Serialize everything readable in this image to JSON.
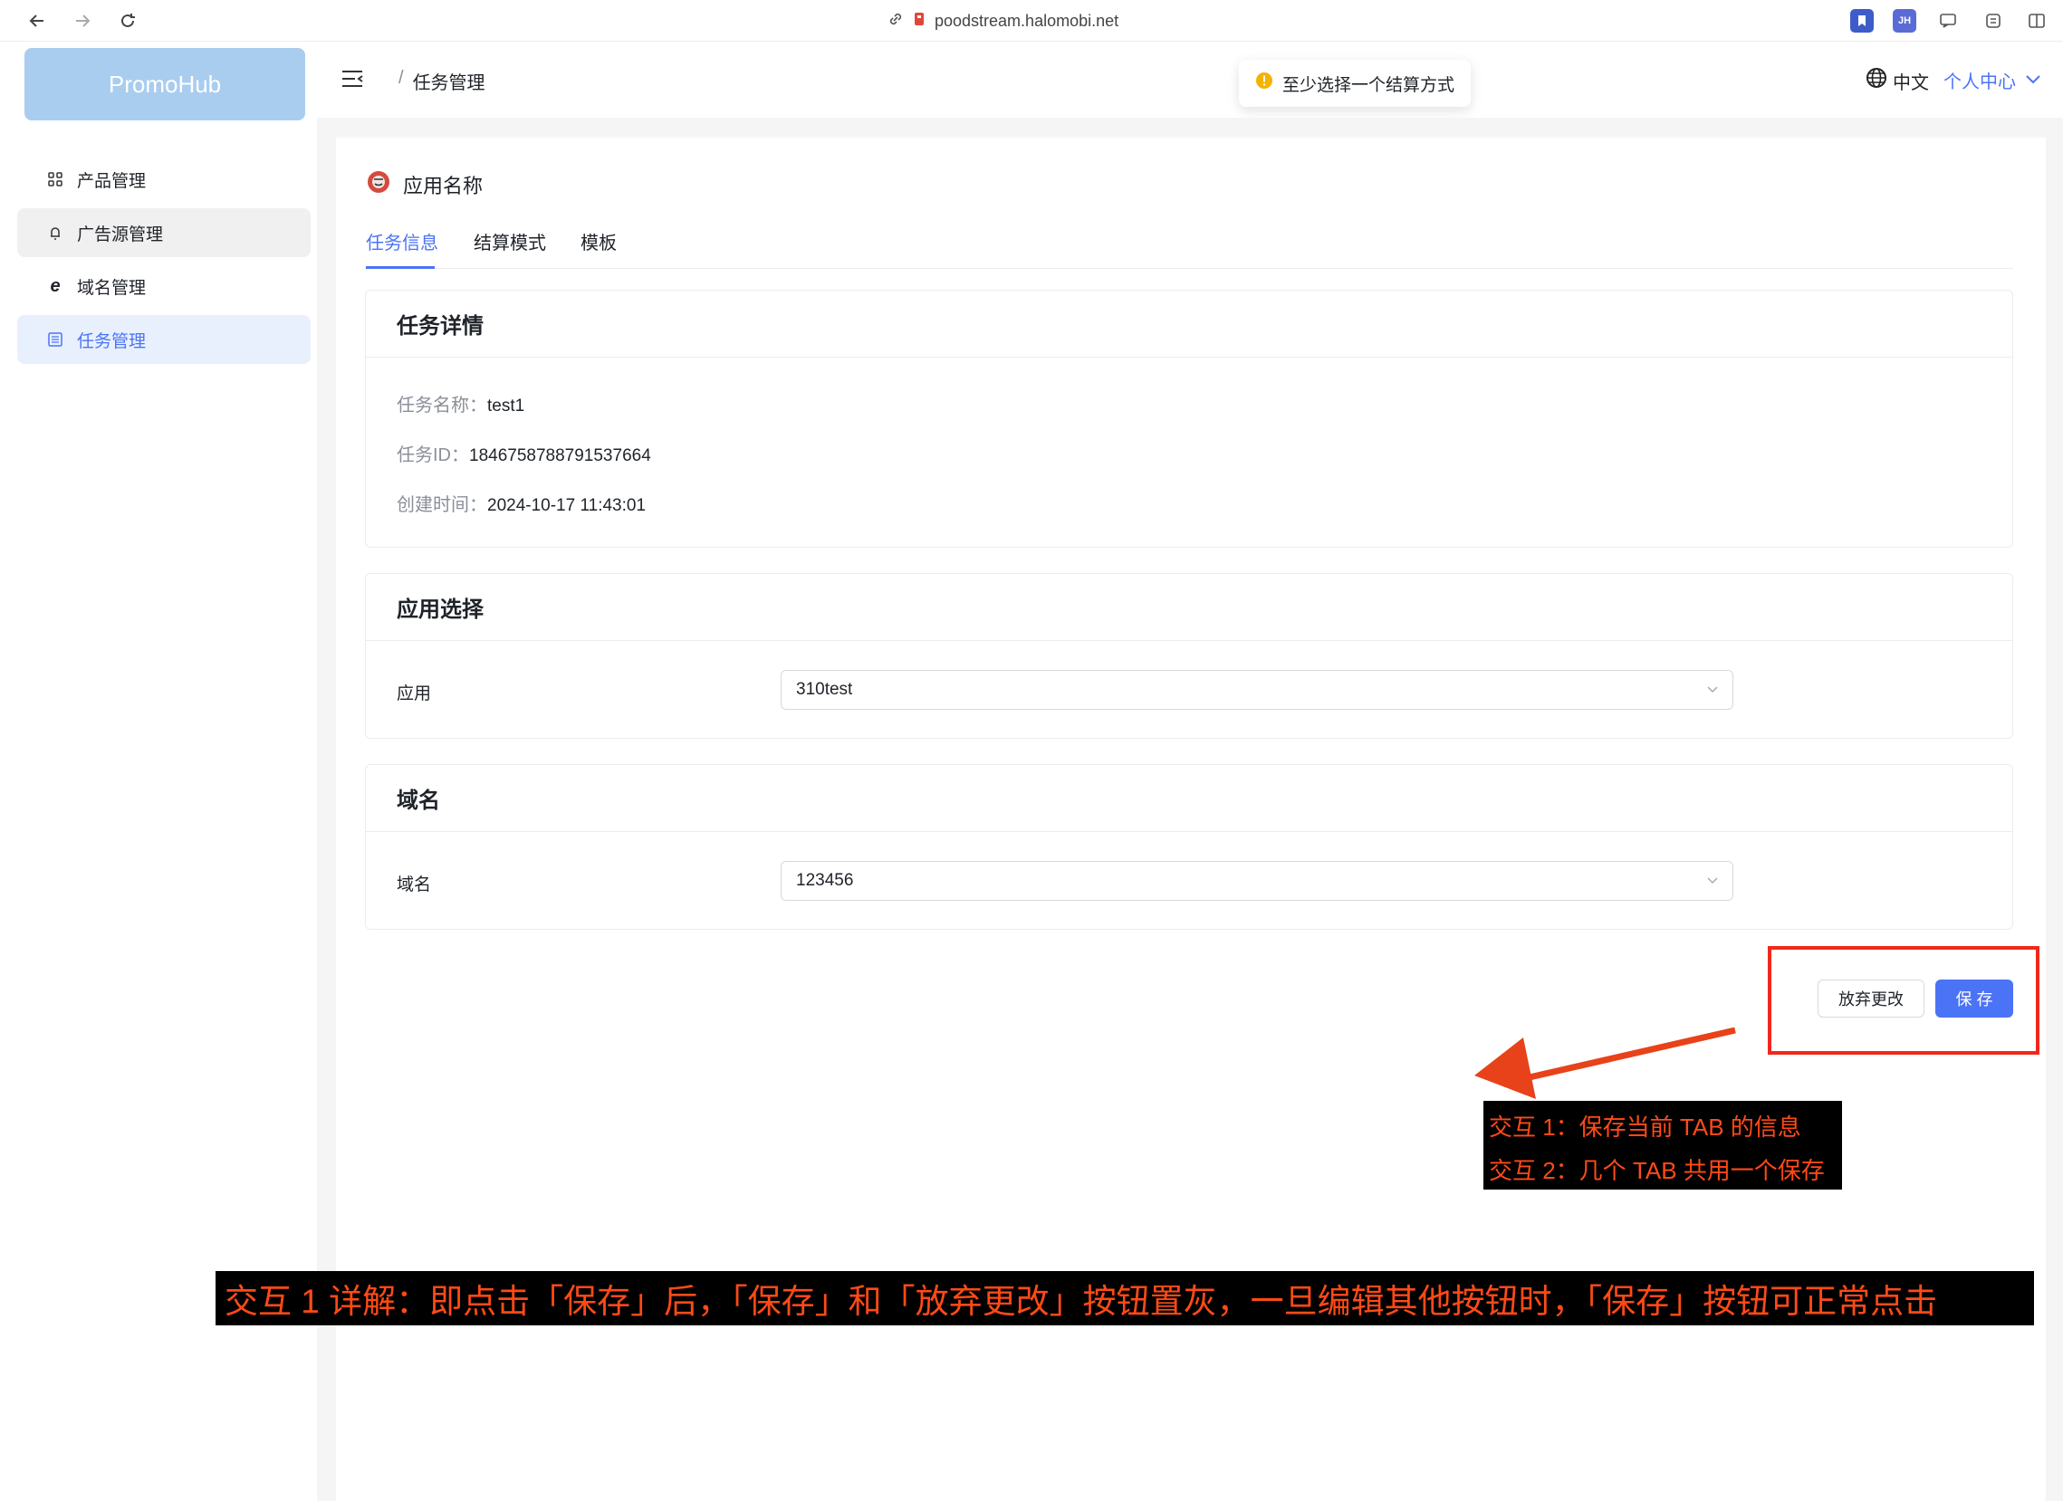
{
  "browser": {
    "url": "poodstream.halomobi.net"
  },
  "app": {
    "brand": "PromoHub"
  },
  "sidebar": {
    "items": [
      {
        "label": "产品管理",
        "icon": "grid-icon"
      },
      {
        "label": "广告源管理",
        "icon": "bell-icon"
      },
      {
        "label": "域名管理",
        "icon": "ie-icon"
      },
      {
        "label": "任务管理",
        "icon": "list-icon"
      }
    ]
  },
  "header": {
    "breadcrumb_sep": "/",
    "breadcrumb": "任务管理",
    "toast": "至少选择一个结算方式",
    "language": "中文",
    "user_center": "个人中心"
  },
  "page": {
    "app_title": "应用名称",
    "tabs": [
      "任务信息",
      "结算模式",
      "模板"
    ],
    "task_details": {
      "title": "任务详情",
      "rows": [
        {
          "label": "任务名称：",
          "value": "test1"
        },
        {
          "label": "任务ID：",
          "value": "1846758788791537664"
        },
        {
          "label": "创建时间：",
          "value": "2024-10-17 11:43:01"
        }
      ]
    },
    "app_select": {
      "title": "应用选择",
      "label": "应用",
      "value": "310test"
    },
    "domain": {
      "title": "域名",
      "label": "域名",
      "value": "123456"
    },
    "actions": {
      "discard": "放弃更改",
      "save": "保 存"
    }
  },
  "annotations": {
    "note1": "交互 1：保存当前 TAB 的信息",
    "note2": "交互 2：几个 TAB 共用一个保存",
    "detail": "交互 1 详解：即点击「保存」后，「保存」和「放弃更改」按钮置灰，一旦编辑其他按钮时，「保存」按钮可正常点击",
    "accent": "#f03a17",
    "primary": "#4b73f5"
  }
}
